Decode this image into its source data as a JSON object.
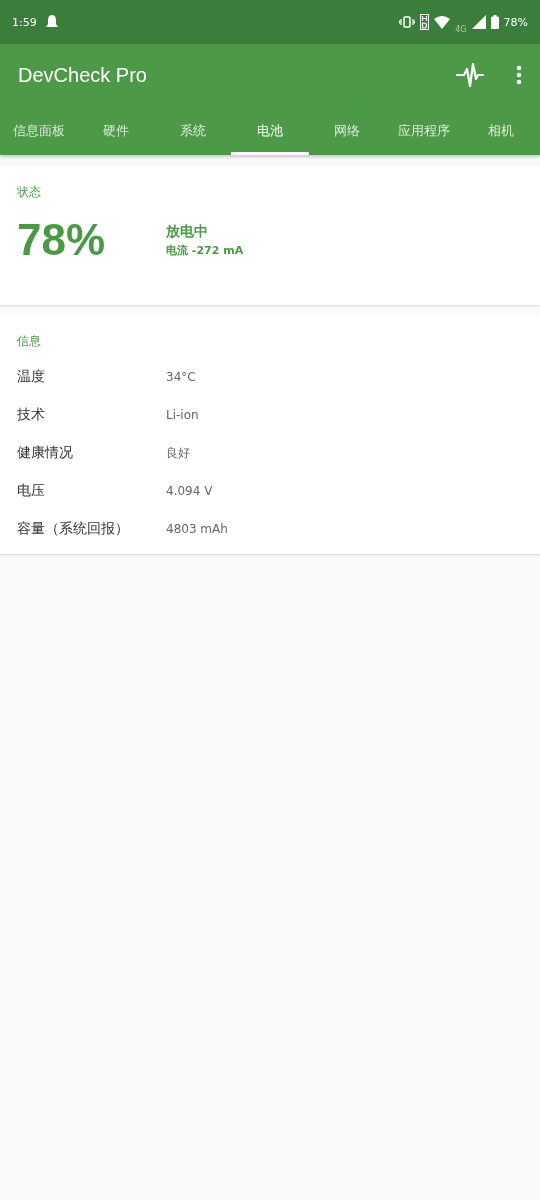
{
  "status_bar": {
    "time": "1:59",
    "network": "4G",
    "battery": "78%"
  },
  "app_bar": {
    "title": "DevCheck Pro"
  },
  "tabs": [
    {
      "label": "信息面板",
      "selected": false
    },
    {
      "label": "硬件",
      "selected": false
    },
    {
      "label": "系统",
      "selected": false
    },
    {
      "label": "电池",
      "selected": true
    },
    {
      "label": "网络",
      "selected": false
    },
    {
      "label": "应用程序",
      "selected": false
    },
    {
      "label": "相机",
      "selected": false
    }
  ],
  "status_card": {
    "heading": "状态",
    "percent": "78%",
    "state": "放电中",
    "current": "电流 -272 mA"
  },
  "info_card": {
    "heading": "信息",
    "rows": [
      {
        "label": "温度",
        "value": "34°C"
      },
      {
        "label": "技术",
        "value": "Li-ion"
      },
      {
        "label": "健康情况",
        "value": "良好"
      },
      {
        "label": "电压",
        "value": "4.094 V"
      },
      {
        "label": "容量（系统回报）",
        "value": "4803 mAh"
      }
    ]
  }
}
